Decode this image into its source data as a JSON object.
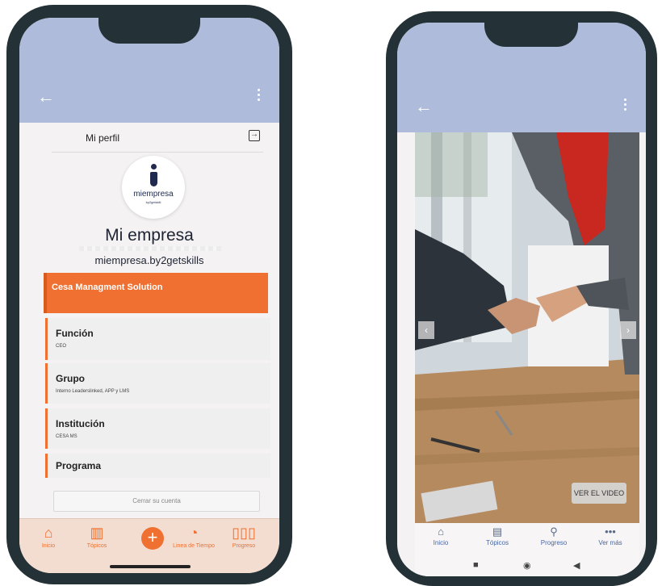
{
  "left_phone": {
    "appbar": {
      "back_icon": "arrow-left-icon",
      "menu_icon": "more-vertical-icon"
    },
    "profile": {
      "title": "Mi perfil",
      "logout_icon": "logout-icon",
      "logo_word": "miempresa",
      "logo_sub": "by2getskill",
      "company_name": "Mi empresa",
      "company_url": "miempresa.by2getskills"
    },
    "highlight": "Cesa Managment Solution",
    "cards": [
      {
        "title": "Función",
        "value": "CEO"
      },
      {
        "title": "Grupo",
        "value": "Interno Leaderslinked, APP y LMS"
      },
      {
        "title": "Institución",
        "value": "CESA MS"
      },
      {
        "title": "Programa",
        "value": ""
      }
    ],
    "close_account": "Cerrar su cuenta",
    "bottom_nav": [
      {
        "label": "Inicio",
        "icon": "home-icon"
      },
      {
        "label": "Tópicos",
        "icon": "topics-icon"
      },
      {
        "label": "Linea de Tiempo",
        "icon": "history-icon"
      },
      {
        "label": "Progreso",
        "icon": "bar-chart-icon"
      }
    ],
    "fab": "+",
    "accent": "#ef7030",
    "appbar_color": "#aebbdb"
  },
  "right_phone": {
    "appbar": {
      "back_icon": "arrow-left-icon",
      "menu_icon": "more-vertical-icon"
    },
    "image": "handshake-photo",
    "prev": "‹",
    "next": "›",
    "video_button": "VER EL VIDEO",
    "bottom_nav": [
      {
        "label": "Inicio",
        "icon": "home-icon"
      },
      {
        "label": "Tópicos",
        "icon": "topics-icon"
      },
      {
        "label": "Progreso",
        "icon": "progress-icon"
      },
      {
        "label": "Ver más",
        "icon": "more-horizontal-icon"
      }
    ],
    "system_nav": [
      "■",
      "◉",
      "◀"
    ],
    "nav_color": "#4867a4"
  }
}
